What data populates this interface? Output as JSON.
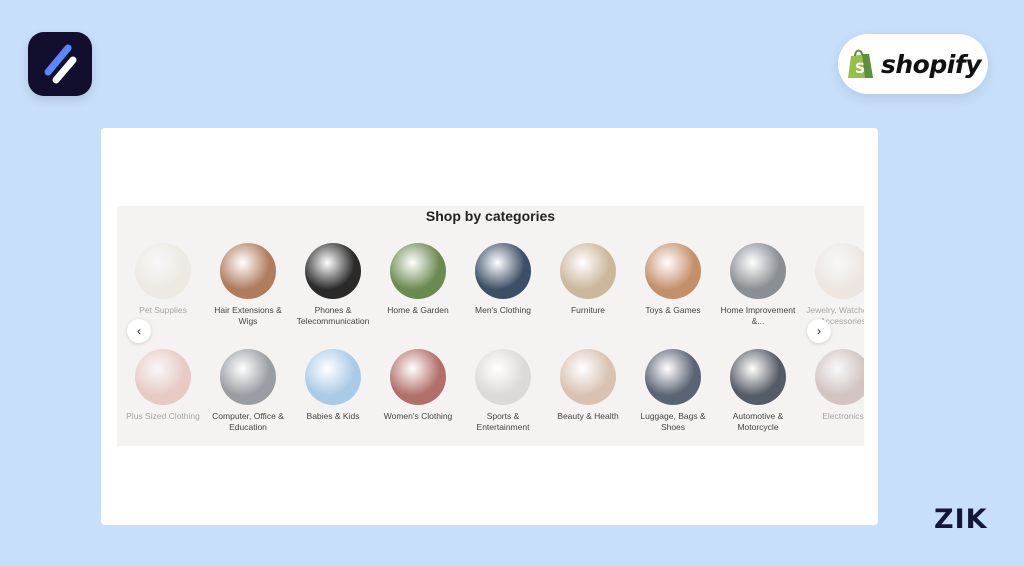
{
  "brand": {
    "shopify_label": "shopify",
    "watermark": "ZIK"
  },
  "section": {
    "title": "Shop by categories"
  },
  "categories_row1": [
    {
      "label": "Pet Supplies",
      "color": "#e7ddd1"
    },
    {
      "label": "Hair Extensions & Wigs",
      "color": "#b07c5e"
    },
    {
      "label": "Phones & Telecommunication",
      "color": "#2a2a2a"
    },
    {
      "label": "Home & Garden",
      "color": "#6b8a4f"
    },
    {
      "label": "Men's Clothing",
      "color": "#3d4f66"
    },
    {
      "label": "Furniture",
      "color": "#cbb79b"
    },
    {
      "label": "Toys & Games",
      "color": "#c4906a"
    },
    {
      "label": "Home Improvement &...",
      "color": "#8a8f94"
    },
    {
      "label": "Jewelry, Watches & Accessories",
      "color": "#e4d6cc"
    }
  ],
  "categories_row2": [
    {
      "label": "Plus Sized Clothing",
      "color": "#d79a8e"
    },
    {
      "label": "Computer, Office & Education",
      "color": "#9a9ea3"
    },
    {
      "label": "Babies & Kids",
      "color": "#a9cbe6"
    },
    {
      "label": "Women's Clothing",
      "color": "#b2706a"
    },
    {
      "label": "Sports & Entertainment",
      "color": "#dcdad6"
    },
    {
      "label": "Beauty & Health",
      "color": "#d9c2b2"
    },
    {
      "label": "Luggage, Bags & Shoes",
      "color": "#5a6474"
    },
    {
      "label": "Automotive & Motorcycle",
      "color": "#565c66"
    },
    {
      "label": "Electronics",
      "color": "#a88c86"
    }
  ],
  "nav": {
    "prev_icon": "‹",
    "next_icon": "›"
  }
}
